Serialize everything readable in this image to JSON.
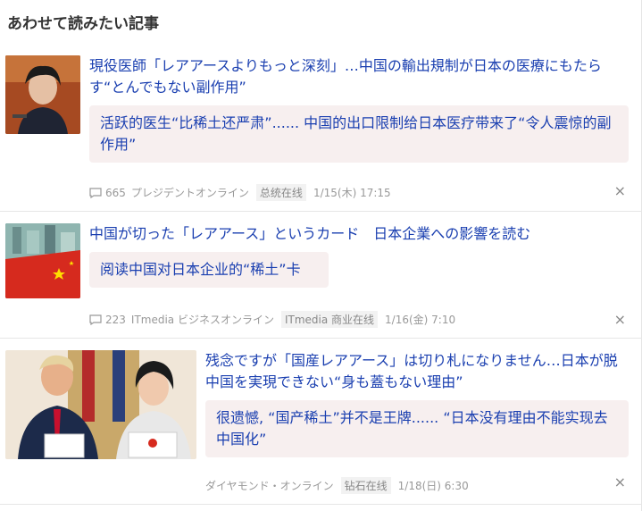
{
  "section": {
    "title": "あわせて読みたい記事"
  },
  "articles": [
    {
      "title": "現役医師「レアアースよりもっと深刻」…中国の輸出規制が日本の医療にもたらす“とんでもない副作用”",
      "translation": "活跃的医生“比稀土还严肃”...... 中国的出口限制给日本医疗带来了“令人震惊的副作用”",
      "comments": "665",
      "source": "プレジデントオンライン",
      "source_tag": "总统在线",
      "date": "1/15(木) 17:15",
      "close": "×"
    },
    {
      "title": "中国が切った「レアアース」というカード　日本企業への影響を読む",
      "translation": "阅读中国对日本企业的“稀土”卡",
      "comments": "223",
      "source": "ITmedia ビジネスオンライン",
      "source_tag": "ITmedia 商业在线",
      "date": "1/16(金) 7:10",
      "close": "×"
    },
    {
      "title": "残念ですが「国産レアアース」は切り札になりません…日本が脱中国を実現できない“身も蓋もない理由”",
      "translation": "很遗憾, “国产稀土”并不是王牌...... “日本没有理由不能实现去中国化”",
      "source": "ダイヤモンド・オンライン",
      "source_tag": "钻石在线",
      "date": "1/18(日) 6:30",
      "close": "×"
    }
  ]
}
